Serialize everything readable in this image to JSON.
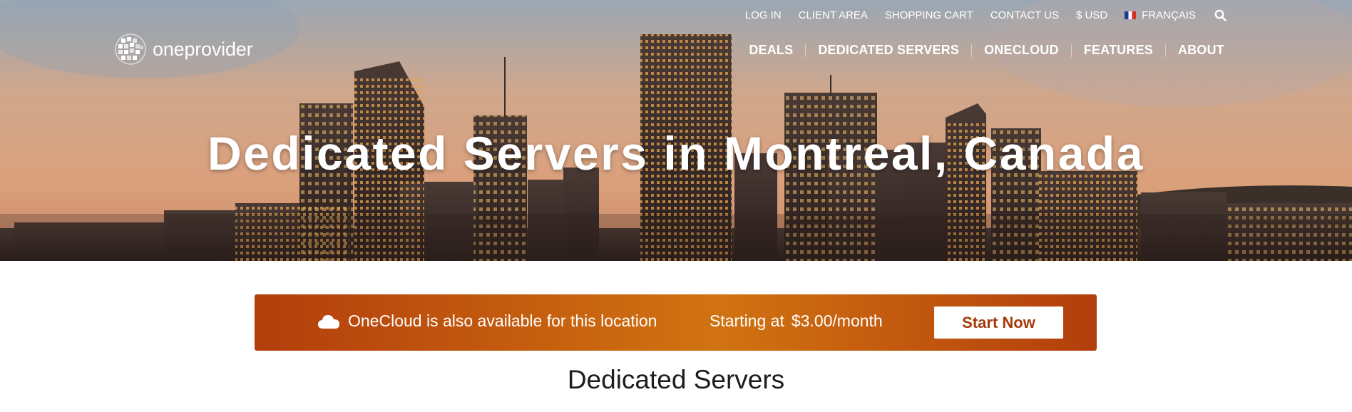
{
  "header": {
    "logo_text": "oneprovider",
    "utility_nav": [
      {
        "label": "LOG IN"
      },
      {
        "label": "CLIENT AREA"
      },
      {
        "label": "SHOPPING CART"
      },
      {
        "label": "CONTACT US"
      },
      {
        "label": "$ USD"
      },
      {
        "label": "FRANÇAIS"
      }
    ],
    "main_nav": [
      {
        "label": "DEALS"
      },
      {
        "label": "DEDICATED SERVERS"
      },
      {
        "label": "ONECLOUD"
      },
      {
        "label": "FEATURES"
      },
      {
        "label": "ABOUT"
      }
    ],
    "icons": {
      "search": "search-icon",
      "language_flag": "france-flag-icon",
      "logo": "globe-logo-icon"
    }
  },
  "hero": {
    "title": "Dedicated Servers in Montreal, Canada"
  },
  "banner": {
    "message": "OneCloud is also available for this location",
    "price_prefix": "Starting at",
    "price": "$3.00/month",
    "cta_label": "Start Now",
    "icon": "cloud-icon",
    "colors": {
      "gradient_edge": "#b23e0c",
      "gradient_center": "#d17311",
      "cta_text": "#a53a0c"
    }
  },
  "content": {
    "section_title": "Dedicated Servers"
  }
}
